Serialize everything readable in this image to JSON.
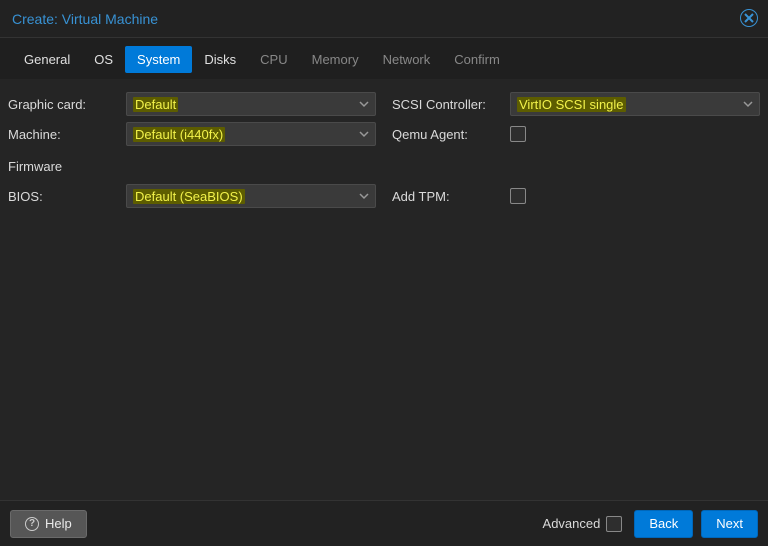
{
  "window": {
    "title": "Create: Virtual Machine"
  },
  "tabs": [
    {
      "label": "General",
      "state": "enabled"
    },
    {
      "label": "OS",
      "state": "enabled"
    },
    {
      "label": "System",
      "state": "active"
    },
    {
      "label": "Disks",
      "state": "enabled"
    },
    {
      "label": "CPU",
      "state": "disabled"
    },
    {
      "label": "Memory",
      "state": "disabled"
    },
    {
      "label": "Network",
      "state": "disabled"
    },
    {
      "label": "Confirm",
      "state": "disabled"
    }
  ],
  "form": {
    "left": {
      "graphic_card": {
        "label": "Graphic card:",
        "value": "Default",
        "highlighted": true
      },
      "machine": {
        "label": "Machine:",
        "value": "Default (i440fx)",
        "highlighted": true
      },
      "firmware": {
        "label": "Firmware"
      },
      "bios": {
        "label": "BIOS:",
        "value": "Default (SeaBIOS)",
        "highlighted": true
      }
    },
    "right": {
      "scsi_controller": {
        "label": "SCSI Controller:",
        "value": "VirtIO SCSI single",
        "highlighted": true
      },
      "qemu_agent": {
        "label": "Qemu Agent:",
        "checked": false
      },
      "add_tpm": {
        "label": "Add TPM:",
        "checked": false
      }
    }
  },
  "footer": {
    "help": "Help",
    "advanced": "Advanced",
    "advanced_checked": false,
    "back": "Back",
    "next": "Next"
  }
}
